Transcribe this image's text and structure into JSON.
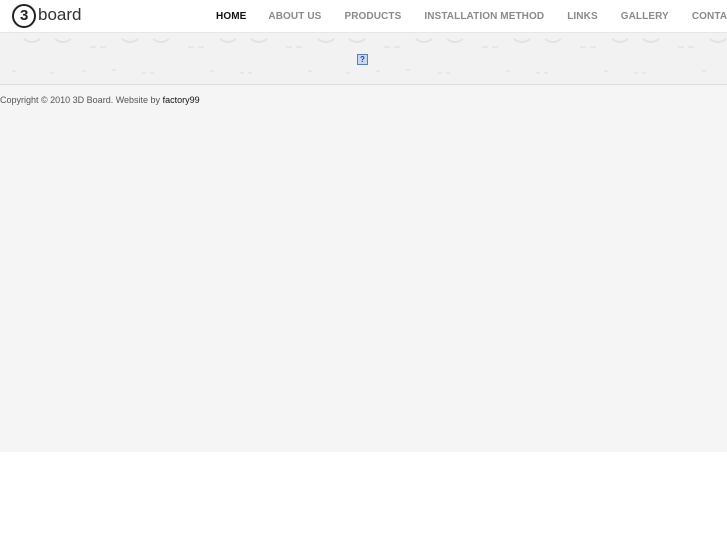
{
  "logo": {
    "mark": "3",
    "text": "board"
  },
  "nav": {
    "items": [
      {
        "label": "HOME",
        "active": true
      },
      {
        "label": "ABOUT US",
        "active": false
      },
      {
        "label": "PRODUCTS",
        "active": false
      },
      {
        "label": "INSTALLATION METHOD",
        "active": false
      },
      {
        "label": "LINKS",
        "active": false
      },
      {
        "label": "GALLERY",
        "active": false
      },
      {
        "label": "CONTACT US",
        "active": false
      }
    ]
  },
  "banner": {
    "placeholder_icon": "broken-image-icon",
    "placeholder_glyph": "?"
  },
  "footer": {
    "copyright": "Copyright © 2010 3D Board. Website by",
    "link_label": "factory99"
  },
  "colors": {
    "page_background": "#f5f5f5",
    "header_background": "#ffffff",
    "nav_active": "#111111",
    "nav_inactive": "#8a8a8a"
  }
}
